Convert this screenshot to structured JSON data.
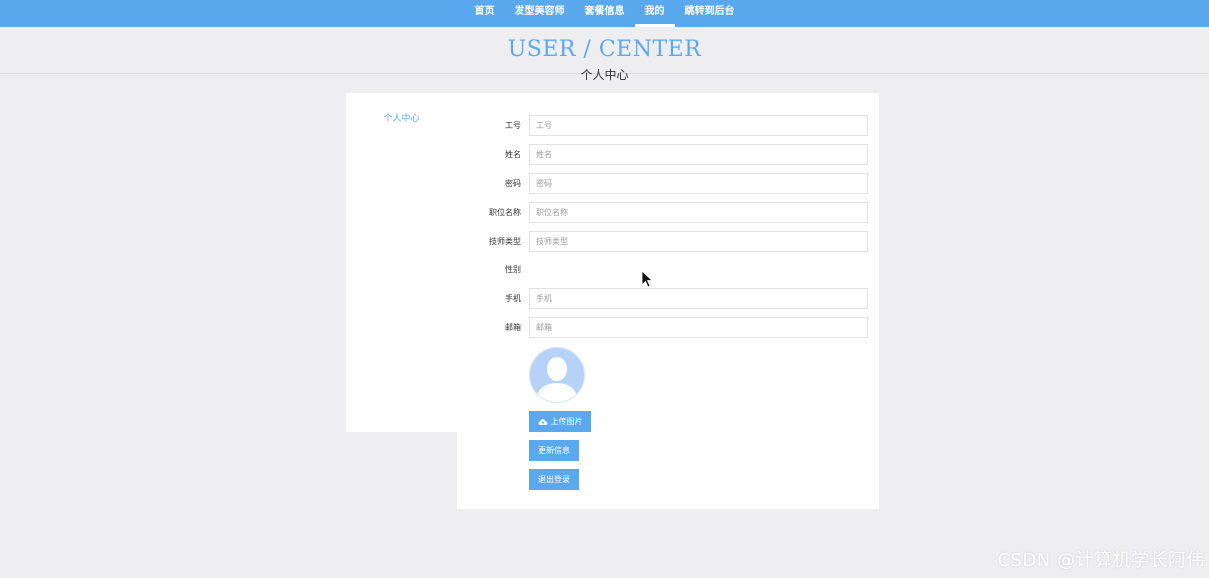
{
  "nav": {
    "items": [
      {
        "label": "首页"
      },
      {
        "label": "发型美容师"
      },
      {
        "label": "套餐信息"
      },
      {
        "label": "我的",
        "active": true
      },
      {
        "label": "跳转到后台"
      }
    ]
  },
  "header": {
    "title_en": "USER / CENTER",
    "title_cn": "个人中心"
  },
  "sidebar": {
    "items": [
      {
        "label": "个人中心"
      }
    ]
  },
  "form": {
    "fields": [
      {
        "label": "工号",
        "placeholder": "工号",
        "value": ""
      },
      {
        "label": "姓名",
        "placeholder": "姓名",
        "value": ""
      },
      {
        "label": "密码",
        "placeholder": "密码",
        "value": ""
      },
      {
        "label": "职位名称",
        "placeholder": "职位名称",
        "value": ""
      },
      {
        "label": "技师类型",
        "placeholder": "技师类型",
        "value": ""
      },
      {
        "label": "性别"
      },
      {
        "label": "手机",
        "placeholder": "手机",
        "value": ""
      },
      {
        "label": "邮箱",
        "placeholder": "邮箱",
        "value": ""
      }
    ],
    "upload_label": "上传图片",
    "update_label": "更新信息",
    "logout_label": "退出登录",
    "upload_icon": "cloud-upload-icon",
    "avatar_icon": "user-avatar-icon"
  },
  "colors": {
    "accent": "#5aa9ef",
    "background": "#eeeef0",
    "panel": "#ffffff"
  },
  "watermark": "CSDN @计算机学长阿伟"
}
